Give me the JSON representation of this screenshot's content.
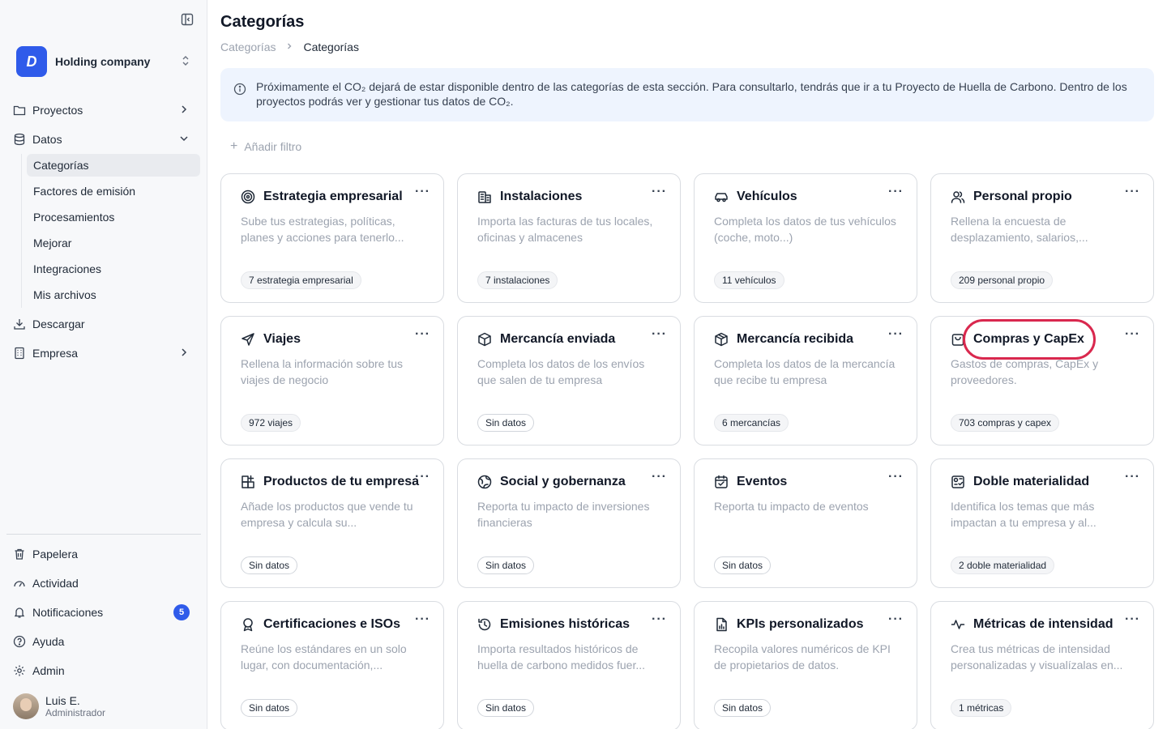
{
  "company": {
    "name": "Holding company"
  },
  "nav": {
    "proyectos": "Proyectos",
    "datos": "Datos",
    "sub": [
      "Categorías",
      "Factores de emisión",
      "Procesamientos",
      "Mejorar",
      "Integraciones",
      "Mis archivos"
    ],
    "descargar": "Descargar",
    "empresa": "Empresa",
    "papelera": "Papelera",
    "actividad": "Actividad",
    "notificaciones": "Notificaciones",
    "notif_count": "5",
    "ayuda": "Ayuda",
    "admin": "Admin"
  },
  "user": {
    "name": "Luis E.",
    "role": "Administrador"
  },
  "page": {
    "title": "Categorías",
    "breadcrumb": [
      "Categorías",
      "Categorías"
    ]
  },
  "info_banner": "Próximamente el CO₂ dejará de estar disponible dentro de las categorías de esta sección. Para consultarlo, tendrás que ir a tu Proyecto de Huella de Carbono. Dentro de los proyectos podrás ver y gestionar tus datos de CO₂.",
  "add_filter": "Añadir filtro",
  "cards": [
    {
      "icon": "target-icon",
      "title": "Estrategia empresarial",
      "desc": "Sube tus estrategias, políticas, planes y acciones para tenerlo...",
      "pill": "7 estrategia empresarial"
    },
    {
      "icon": "building-icon",
      "title": "Instalaciones",
      "desc": "Importa las facturas de tus locales, oficinas y almacenes",
      "pill": "7 instalaciones"
    },
    {
      "icon": "car-icon",
      "title": "Vehículos",
      "desc": "Completa los datos de tus vehículos (coche, moto...)",
      "pill": "11 vehículos"
    },
    {
      "icon": "users-icon",
      "title": "Personal propio",
      "desc": "Rellena la encuesta de desplazamiento, salarios,...",
      "pill": "209 personal propio"
    },
    {
      "icon": "plane-icon",
      "title": "Viajes",
      "desc": "Rellena la información sobre tus viajes de negocio",
      "pill": "972 viajes"
    },
    {
      "icon": "box-icon",
      "title": "Mercancía enviada",
      "desc": "Completa los datos de los envíos que salen de tu empresa",
      "pill": "Sin datos"
    },
    {
      "icon": "boxes-icon",
      "title": "Mercancía recibida",
      "desc": "Completa los datos de la mercancía que recibe tu empresa",
      "pill": "6 mercancías"
    },
    {
      "icon": "shopping-bag-icon",
      "title": "Compras y CapEx",
      "desc": "Gastos de compras, CapEx y proveedores.",
      "pill": "703 compras y capex"
    },
    {
      "icon": "grid-plus-icon",
      "title": "Productos de tu empresa",
      "desc": "Añade los productos que vende tu empresa y calcula su...",
      "pill": "Sin datos"
    },
    {
      "icon": "globe-icon",
      "title": "Social y gobernanza",
      "desc": "Reporta tu impacto de inversiones financieras",
      "pill": "Sin datos"
    },
    {
      "icon": "calendar-icon",
      "title": "Eventos",
      "desc": "Reporta tu impacto de eventos",
      "pill": "Sin datos"
    },
    {
      "icon": "matrix-icon",
      "title": "Doble materialidad",
      "desc": "Identifica los temas que más impactan a tu empresa y al...",
      "pill": "2 doble materialidad"
    },
    {
      "icon": "award-icon",
      "title": "Certificaciones e ISOs",
      "desc": "Reúne los estándares en un solo lugar, con documentación,...",
      "pill": "Sin datos"
    },
    {
      "icon": "history-icon",
      "title": "Emisiones históricas",
      "desc": "Importa resultados históricos de huella de carbono medidos fuer...",
      "pill": "Sin datos"
    },
    {
      "icon": "file-chart-icon",
      "title": "KPIs personalizados",
      "desc": "Recopila valores numéricos de KPI de propietarios de datos.",
      "pill": "Sin datos"
    },
    {
      "icon": "activity-icon",
      "title": "Métricas de intensidad",
      "desc": "Crea tus métricas de intensidad personalizadas y visualízalas en...",
      "pill": "1 métricas"
    }
  ]
}
